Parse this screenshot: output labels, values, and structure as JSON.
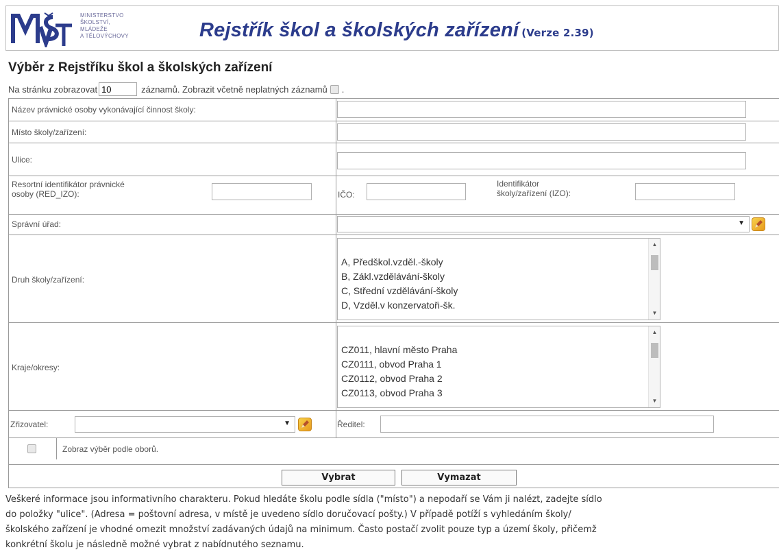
{
  "header": {
    "ministry_lines": [
      "MINISTERSTVO",
      "ŠKOLSTVÍ,",
      "MLÁDEŽE",
      "A TĚLOVÝCHOVY"
    ],
    "app_title": "Rejstřík škol a školských zařízení",
    "version": "(Verze 2.39)"
  },
  "page": {
    "title": "Výběr z Rejstříku škol a školských zařízení",
    "per_page_prefix": "Na stránku zobrazovat",
    "per_page_value": "10",
    "per_page_suffix": "záznamů. Zobrazit včetně neplatných záznamů",
    "per_page_end": "."
  },
  "form": {
    "nazev_label": "Název právnické osoby vykonávající činnost školy:",
    "misto_label": "Místo školy/zařízení:",
    "ulice_label": "Ulice:",
    "red_izo_label_1": "Resortní identifikátor právnické",
    "red_izo_label_2": "osoby (RED_IZO):",
    "ico_label": "IČO:",
    "izo_label_1": "Identifikátor",
    "izo_label_2": "školy/zařízení (IZO):",
    "spravni_urad_label": "Správní úřad:",
    "druh_label": "Druh školy/zařízení:",
    "druh_options": [
      "A, Předškol.vzděl.-školy",
      "B, Zákl.vzdělávání-školy",
      "C, Střední vzdělávání-školy",
      "D, Vzděl.v konzervatoři-šk."
    ],
    "kraje_label": "Kraje/okresy:",
    "kraje_options": [
      "CZ011, hlavní město Praha",
      "CZ0111, obvod Praha 1",
      "CZ0112, obvod Praha 2",
      "CZ0113, obvod Praha 3"
    ],
    "zrizovatel_label": "Zřizovatel:",
    "reditel_label": "Ředitel:",
    "obory_label": "Zobraz výběr podle oborů.",
    "submit_label": "Vybrat",
    "clear_label": "Vymazat"
  },
  "footer": {
    "lines": [
      "Veškeré informace jsou informativního charakteru. Pokud hledáte školu podle sídla (\"místo\") a nepodaří se Vám ji nalézt, zadejte sídlo",
      "do položky \"ulice\". (Adresa = poštovní adresa, v místě je uvedeno sídlo doručovací pošty.) V případě potíží s vyhledáním školy/",
      "školského zařízení je vhodné omezit množství zadávaných údajů na minimum. Často postačí zvolit pouze typ a území školy, přičemž",
      "konkrétní školu je následně možné vybrat z nabídnutého seznamu."
    ]
  }
}
